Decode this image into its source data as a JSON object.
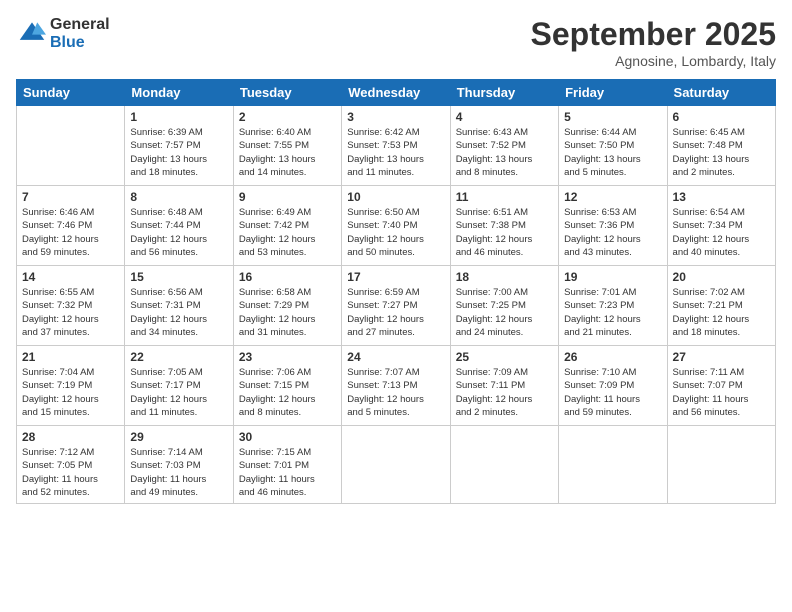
{
  "header": {
    "logo_line1": "General",
    "logo_line2": "Blue",
    "month": "September 2025",
    "location": "Agnosine, Lombardy, Italy"
  },
  "weekdays": [
    "Sunday",
    "Monday",
    "Tuesday",
    "Wednesday",
    "Thursday",
    "Friday",
    "Saturday"
  ],
  "weeks": [
    [
      {
        "day": "",
        "info": ""
      },
      {
        "day": "1",
        "info": "Sunrise: 6:39 AM\nSunset: 7:57 PM\nDaylight: 13 hours\nand 18 minutes."
      },
      {
        "day": "2",
        "info": "Sunrise: 6:40 AM\nSunset: 7:55 PM\nDaylight: 13 hours\nand 14 minutes."
      },
      {
        "day": "3",
        "info": "Sunrise: 6:42 AM\nSunset: 7:53 PM\nDaylight: 13 hours\nand 11 minutes."
      },
      {
        "day": "4",
        "info": "Sunrise: 6:43 AM\nSunset: 7:52 PM\nDaylight: 13 hours\nand 8 minutes."
      },
      {
        "day": "5",
        "info": "Sunrise: 6:44 AM\nSunset: 7:50 PM\nDaylight: 13 hours\nand 5 minutes."
      },
      {
        "day": "6",
        "info": "Sunrise: 6:45 AM\nSunset: 7:48 PM\nDaylight: 13 hours\nand 2 minutes."
      }
    ],
    [
      {
        "day": "7",
        "info": "Sunrise: 6:46 AM\nSunset: 7:46 PM\nDaylight: 12 hours\nand 59 minutes."
      },
      {
        "day": "8",
        "info": "Sunrise: 6:48 AM\nSunset: 7:44 PM\nDaylight: 12 hours\nand 56 minutes."
      },
      {
        "day": "9",
        "info": "Sunrise: 6:49 AM\nSunset: 7:42 PM\nDaylight: 12 hours\nand 53 minutes."
      },
      {
        "day": "10",
        "info": "Sunrise: 6:50 AM\nSunset: 7:40 PM\nDaylight: 12 hours\nand 50 minutes."
      },
      {
        "day": "11",
        "info": "Sunrise: 6:51 AM\nSunset: 7:38 PM\nDaylight: 12 hours\nand 46 minutes."
      },
      {
        "day": "12",
        "info": "Sunrise: 6:53 AM\nSunset: 7:36 PM\nDaylight: 12 hours\nand 43 minutes."
      },
      {
        "day": "13",
        "info": "Sunrise: 6:54 AM\nSunset: 7:34 PM\nDaylight: 12 hours\nand 40 minutes."
      }
    ],
    [
      {
        "day": "14",
        "info": "Sunrise: 6:55 AM\nSunset: 7:32 PM\nDaylight: 12 hours\nand 37 minutes."
      },
      {
        "day": "15",
        "info": "Sunrise: 6:56 AM\nSunset: 7:31 PM\nDaylight: 12 hours\nand 34 minutes."
      },
      {
        "day": "16",
        "info": "Sunrise: 6:58 AM\nSunset: 7:29 PM\nDaylight: 12 hours\nand 31 minutes."
      },
      {
        "day": "17",
        "info": "Sunrise: 6:59 AM\nSunset: 7:27 PM\nDaylight: 12 hours\nand 27 minutes."
      },
      {
        "day": "18",
        "info": "Sunrise: 7:00 AM\nSunset: 7:25 PM\nDaylight: 12 hours\nand 24 minutes."
      },
      {
        "day": "19",
        "info": "Sunrise: 7:01 AM\nSunset: 7:23 PM\nDaylight: 12 hours\nand 21 minutes."
      },
      {
        "day": "20",
        "info": "Sunrise: 7:02 AM\nSunset: 7:21 PM\nDaylight: 12 hours\nand 18 minutes."
      }
    ],
    [
      {
        "day": "21",
        "info": "Sunrise: 7:04 AM\nSunset: 7:19 PM\nDaylight: 12 hours\nand 15 minutes."
      },
      {
        "day": "22",
        "info": "Sunrise: 7:05 AM\nSunset: 7:17 PM\nDaylight: 12 hours\nand 11 minutes."
      },
      {
        "day": "23",
        "info": "Sunrise: 7:06 AM\nSunset: 7:15 PM\nDaylight: 12 hours\nand 8 minutes."
      },
      {
        "day": "24",
        "info": "Sunrise: 7:07 AM\nSunset: 7:13 PM\nDaylight: 12 hours\nand 5 minutes."
      },
      {
        "day": "25",
        "info": "Sunrise: 7:09 AM\nSunset: 7:11 PM\nDaylight: 12 hours\nand 2 minutes."
      },
      {
        "day": "26",
        "info": "Sunrise: 7:10 AM\nSunset: 7:09 PM\nDaylight: 11 hours\nand 59 minutes."
      },
      {
        "day": "27",
        "info": "Sunrise: 7:11 AM\nSunset: 7:07 PM\nDaylight: 11 hours\nand 56 minutes."
      }
    ],
    [
      {
        "day": "28",
        "info": "Sunrise: 7:12 AM\nSunset: 7:05 PM\nDaylight: 11 hours\nand 52 minutes."
      },
      {
        "day": "29",
        "info": "Sunrise: 7:14 AM\nSunset: 7:03 PM\nDaylight: 11 hours\nand 49 minutes."
      },
      {
        "day": "30",
        "info": "Sunrise: 7:15 AM\nSunset: 7:01 PM\nDaylight: 11 hours\nand 46 minutes."
      },
      {
        "day": "",
        "info": ""
      },
      {
        "day": "",
        "info": ""
      },
      {
        "day": "",
        "info": ""
      },
      {
        "day": "",
        "info": ""
      }
    ]
  ]
}
